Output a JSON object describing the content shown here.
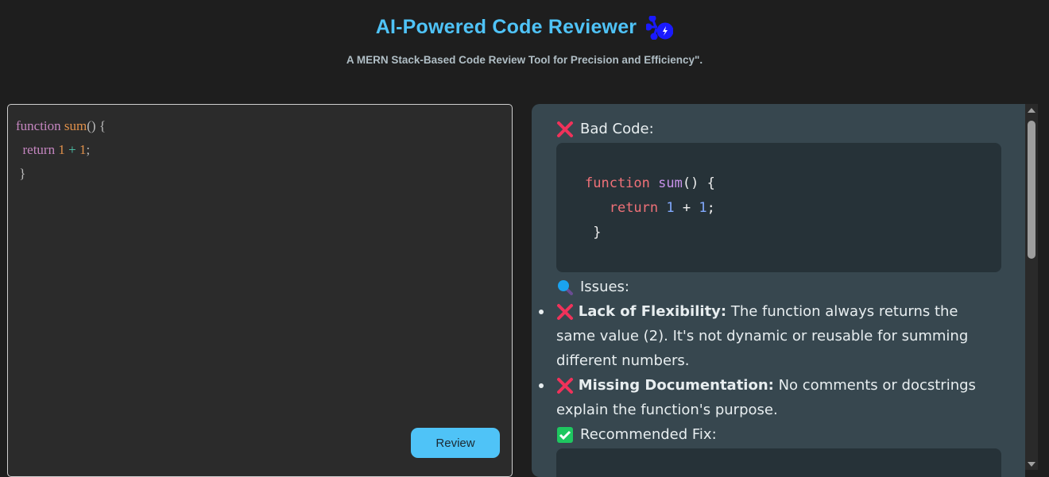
{
  "header": {
    "title": "AI-Powered Code Reviewer",
    "title_icon": "robot-circuit-icon",
    "subtitle": "A MERN Stack-Based Code Review Tool for Precision and Efficiency\"."
  },
  "editor": {
    "code_lines": [
      "function sum() {",
      "  return 1 + 1;",
      " }"
    ],
    "review_button": "Review"
  },
  "review": {
    "bad_code_label": "Bad Code:",
    "bad_code": [
      "function sum() {",
      "   return 1 + 1;",
      " }"
    ],
    "issues_label": "Issues:",
    "issues": [
      {
        "title": "Lack of Flexibility:",
        "text": " The function always returns the same value (2). It's not dynamic or reusable for summing different numbers."
      },
      {
        "title": "Missing Documentation:",
        "text": " No comments or docstrings explain the function's purpose."
      }
    ],
    "fix_label": "Recommended Fix:"
  },
  "colors": {
    "accent": "#4fc3f7",
    "panel": "#37474f",
    "code_bg": "#263238",
    "error": "#f0325a",
    "success": "#1ec760"
  }
}
